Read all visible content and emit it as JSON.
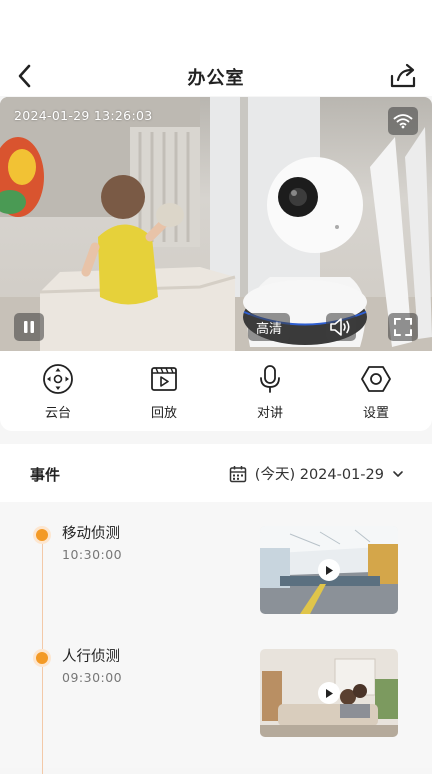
{
  "header": {
    "title": "办公室"
  },
  "video": {
    "timestamp": "2024-01-29 13:26:03",
    "quality_label": "高清"
  },
  "toolbar": [
    {
      "label": "云台",
      "icon": "joystick-icon"
    },
    {
      "label": "回放",
      "icon": "playback-icon"
    },
    {
      "label": "对讲",
      "icon": "microphone-icon"
    },
    {
      "label": "设置",
      "icon": "hexagon-settings-icon"
    }
  ],
  "events": {
    "title": "事件",
    "date_label": "(今天) 2024-01-29",
    "items": [
      {
        "name": "移动侦测",
        "time": "10:30:00"
      },
      {
        "name": "人行侦测",
        "time": "09:30:00"
      }
    ]
  },
  "colors": {
    "accent": "#f39a26",
    "timeline": "#f3c9a8"
  }
}
